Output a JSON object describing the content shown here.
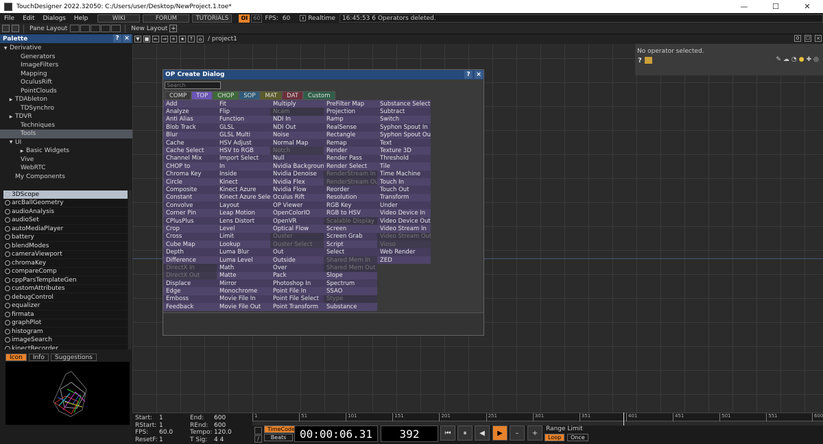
{
  "window": {
    "title": "TouchDesigner 2022.32050: C:/Users/user/Desktop/NewProject.1.toe*",
    "min_glyph": "—",
    "max_glyph": "☐",
    "close_glyph": "✕"
  },
  "menubar": {
    "items": [
      "File",
      "Edit",
      "Dialogs",
      "Help"
    ],
    "wiki": "WIKI",
    "forum": "FORUM",
    "tutorials": "TUTORIALS",
    "oi": "OI",
    "fps_cap": "60",
    "fps_label": "FPS:",
    "fps_value": "60",
    "realtime_check": "X",
    "realtime_label": "Realtime",
    "status_text": "16:45:53 6 Operators deleted."
  },
  "toolbar": {
    "pane_layout": "Pane Layout",
    "new_layout": "New Layout",
    "add": "+"
  },
  "palette": {
    "title": "Palette",
    "help_btn": "?",
    "close_btn": "×",
    "tree": [
      {
        "label": "Derivative",
        "indent": 0,
        "arrow": "▼"
      },
      {
        "label": "Generators",
        "indent": 2,
        "arrow": ""
      },
      {
        "label": "ImageFilters",
        "indent": 2,
        "arrow": ""
      },
      {
        "label": "Mapping",
        "indent": 2,
        "arrow": ""
      },
      {
        "label": "OculusRift",
        "indent": 2,
        "arrow": ""
      },
      {
        "label": "PointClouds",
        "indent": 2,
        "arrow": ""
      },
      {
        "label": "TDAbleton",
        "indent": 1,
        "arrow": "▶"
      },
      {
        "label": "TDSynchro",
        "indent": 2,
        "arrow": ""
      },
      {
        "label": "TDVR",
        "indent": 1,
        "arrow": "▶"
      },
      {
        "label": "Techniques",
        "indent": 2,
        "arrow": ""
      },
      {
        "label": "Tools",
        "indent": 2,
        "arrow": "",
        "selected": true
      },
      {
        "label": "UI",
        "indent": 1,
        "arrow": "▼"
      },
      {
        "label": "Basic Widgets",
        "indent": 3,
        "arrow": "▶"
      },
      {
        "label": "Vive",
        "indent": 2,
        "arrow": ""
      },
      {
        "label": "WebRTC",
        "indent": 2,
        "arrow": ""
      },
      {
        "label": "My Components",
        "indent": 1,
        "arrow": ""
      }
    ],
    "components": [
      "3DScope",
      "arcBallGeometry",
      "audioAnalysis",
      "audioSet",
      "autoMediaPlayer",
      "battery",
      "blendModes",
      "cameraViewport",
      "chromaKey",
      "compareComp",
      "cppParsTemplateGen",
      "customAttributes",
      "debugControl",
      "equalizer",
      "firmata",
      "graphPlot",
      "histogram",
      "imageSearch",
      "kinectRecorder"
    ],
    "tabs": [
      "Icon",
      "Info",
      "Suggestions"
    ]
  },
  "network": {
    "path": "/ project1",
    "right_num": "0"
  },
  "params": {
    "message": "No operator selected.",
    "q": "?"
  },
  "opdialog": {
    "title": "OP Create Dialog",
    "help_btn": "?",
    "close_btn": "×",
    "search_placeholder": "Search",
    "families": [
      {
        "label": "COMP",
        "color": "#3a3a3a"
      },
      {
        "label": "TOP",
        "color": "#6a55b4"
      },
      {
        "label": "CHOP",
        "color": "#3e6a3a"
      },
      {
        "label": "SOP",
        "color": "#2f5a78"
      },
      {
        "label": "MAT",
        "color": "#5a5a2a"
      },
      {
        "label": "DAT",
        "color": "#6a2f3a"
      },
      {
        "label": "Custom",
        "color": "#2f5e48"
      }
    ],
    "columns": [
      [
        {
          "n": "Add"
        },
        {
          "n": "Analyze"
        },
        {
          "n": "Anti Alias"
        },
        {
          "n": "Blob Track"
        },
        {
          "n": "Blur"
        },
        {
          "n": "Cache"
        },
        {
          "n": "Cache Select"
        },
        {
          "n": "Channel Mix"
        },
        {
          "n": "CHOP to"
        },
        {
          "n": "Chroma Key"
        },
        {
          "n": "Circle"
        },
        {
          "n": "Composite"
        },
        {
          "n": "Constant"
        },
        {
          "n": "Convolve"
        },
        {
          "n": "Corner Pin"
        },
        {
          "n": "CPlusPlus"
        },
        {
          "n": "Crop"
        },
        {
          "n": "Cross"
        },
        {
          "n": "Cube Map"
        },
        {
          "n": "Depth"
        },
        {
          "n": "Difference"
        },
        {
          "n": "DirectX In",
          "d": true
        },
        {
          "n": "DirectX Out",
          "d": true
        },
        {
          "n": "Displace"
        },
        {
          "n": "Edge"
        },
        {
          "n": "Emboss"
        },
        {
          "n": "Feedback"
        }
      ],
      [
        {
          "n": "Fit"
        },
        {
          "n": "Flip"
        },
        {
          "n": "Function"
        },
        {
          "n": "GLSL"
        },
        {
          "n": "GLSL Multi"
        },
        {
          "n": "HSV Adjust"
        },
        {
          "n": "HSV to RGB"
        },
        {
          "n": "Import Select"
        },
        {
          "n": "In"
        },
        {
          "n": "Inside"
        },
        {
          "n": "Kinect"
        },
        {
          "n": "Kinect Azure"
        },
        {
          "n": "Kinect Azure Select"
        },
        {
          "n": "Layout"
        },
        {
          "n": "Leap Motion"
        },
        {
          "n": "Lens Distort"
        },
        {
          "n": "Level"
        },
        {
          "n": "Limit"
        },
        {
          "n": "Lookup"
        },
        {
          "n": "Luma Blur"
        },
        {
          "n": "Luma Level"
        },
        {
          "n": "Math"
        },
        {
          "n": "Matte"
        },
        {
          "n": "Mirror"
        },
        {
          "n": "Monochrome"
        },
        {
          "n": "Movie File In"
        },
        {
          "n": "Movie File Out"
        }
      ],
      [
        {
          "n": "Multiply"
        },
        {
          "n": "Ncam",
          "d": true
        },
        {
          "n": "NDI In"
        },
        {
          "n": "NDI Out"
        },
        {
          "n": "Noise"
        },
        {
          "n": "Normal Map"
        },
        {
          "n": "Notch",
          "d": true
        },
        {
          "n": "Null"
        },
        {
          "n": "Nvidia Background"
        },
        {
          "n": "Nvidia Denoise"
        },
        {
          "n": "Nvidia Flex"
        },
        {
          "n": "Nvidia Flow"
        },
        {
          "n": "Oculus Rift"
        },
        {
          "n": "OP Viewer"
        },
        {
          "n": "OpenColorIO"
        },
        {
          "n": "OpenVR"
        },
        {
          "n": "Optical Flow"
        },
        {
          "n": "Ouster",
          "d": true
        },
        {
          "n": "Ouster Select",
          "d": true
        },
        {
          "n": "Out"
        },
        {
          "n": "Outside"
        },
        {
          "n": "Over"
        },
        {
          "n": "Pack"
        },
        {
          "n": "Photoshop In"
        },
        {
          "n": "Point File In"
        },
        {
          "n": "Point File Select"
        },
        {
          "n": "Point Transform"
        }
      ],
      [
        {
          "n": "PreFilter Map"
        },
        {
          "n": "Projection"
        },
        {
          "n": "Ramp"
        },
        {
          "n": "RealSense"
        },
        {
          "n": "Rectangle"
        },
        {
          "n": "Remap"
        },
        {
          "n": "Render"
        },
        {
          "n": "Render Pass"
        },
        {
          "n": "Render Select"
        },
        {
          "n": "RenderStream In",
          "d": true
        },
        {
          "n": "RenderStream Out",
          "d": true
        },
        {
          "n": "Reorder"
        },
        {
          "n": "Resolution"
        },
        {
          "n": "RGB Key"
        },
        {
          "n": "RGB to HSV"
        },
        {
          "n": "Scalable Display",
          "d": true
        },
        {
          "n": "Screen"
        },
        {
          "n": "Screen Grab"
        },
        {
          "n": "Script"
        },
        {
          "n": "Select"
        },
        {
          "n": "Shared Mem In",
          "d": true
        },
        {
          "n": "Shared Mem Out",
          "d": true
        },
        {
          "n": "Slope"
        },
        {
          "n": "Spectrum"
        },
        {
          "n": "SSAO"
        },
        {
          "n": "Stype",
          "d": true
        },
        {
          "n": "Substance"
        }
      ],
      [
        {
          "n": "Substance Select"
        },
        {
          "n": "Subtract"
        },
        {
          "n": "Switch"
        },
        {
          "n": "Syphon Spout In"
        },
        {
          "n": "Syphon Spout Out"
        },
        {
          "n": "Text"
        },
        {
          "n": "Texture 3D"
        },
        {
          "n": "Threshold"
        },
        {
          "n": "Tile"
        },
        {
          "n": "Time Machine"
        },
        {
          "n": "Touch In"
        },
        {
          "n": "Touch Out"
        },
        {
          "n": "Transform"
        },
        {
          "n": "Under"
        },
        {
          "n": "Video Device In"
        },
        {
          "n": "Video Device Out"
        },
        {
          "n": "Video Stream In"
        },
        {
          "n": "Video Stream Out",
          "d": true
        },
        {
          "n": "Vioso",
          "d": true
        },
        {
          "n": "Web Render"
        },
        {
          "n": "ZED"
        }
      ]
    ]
  },
  "timeline": {
    "info": [
      {
        "l": "Start:",
        "v": "1",
        "l2": "End:",
        "v2": "600"
      },
      {
        "l": "RStart:",
        "v": "1",
        "l2": "REnd:",
        "v2": "600"
      },
      {
        "l": "FPS:",
        "v": "60.0",
        "l2": "Tempo:",
        "v2": "120.0"
      },
      {
        "l": "ResetF:",
        "v": "1",
        "l2": "T Sig:",
        "v2": "4      4"
      }
    ],
    "ticks": [
      "1",
      "51",
      "101",
      "151",
      "201",
      "251",
      "301",
      "351",
      "401",
      "451",
      "501",
      "551",
      "600"
    ],
    "timecode_btn": "TimeCode",
    "beats_btn": "Beats",
    "timecode": "00:00:06.31",
    "frame": "392",
    "range_limit": "Range Limit",
    "loop": "Loop",
    "once": "Once",
    "controls": [
      "⏮",
      "⏸",
      "◀",
      "▶",
      "–",
      "+"
    ]
  }
}
